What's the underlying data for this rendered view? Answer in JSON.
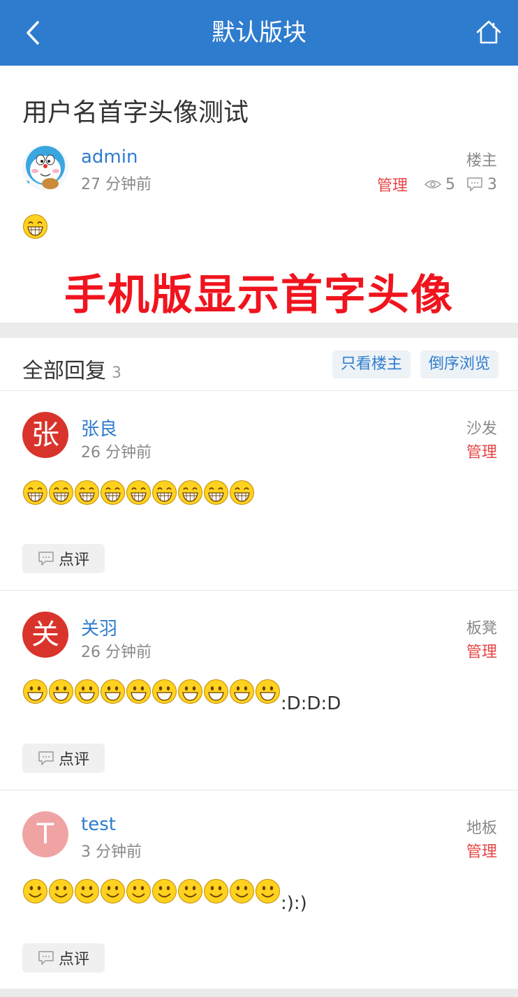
{
  "header": {
    "title": "默认版块"
  },
  "thread": {
    "subject": "用户名首字头像测试",
    "author": "admin",
    "time": "27 分钟前",
    "floor": "楼主",
    "manage": "管理",
    "views": "5",
    "replies": "3",
    "banner": "手机版显示首字头像"
  },
  "replies_section": {
    "label": "全部回复",
    "count": "3",
    "only_op_btn": "只看楼主",
    "reverse_btn": "倒序浏览"
  },
  "replies": [
    {
      "initial": "张",
      "author": "张良",
      "time": "26 分钟前",
      "floor": "沙发",
      "manage": "管理",
      "suffix_text": "",
      "comment": "点评",
      "avatar_color": "#d9342b",
      "emote": "grin",
      "emote_count": 9
    },
    {
      "initial": "关",
      "author": "关羽",
      "time": "26 分钟前",
      "floor": "板凳",
      "manage": "管理",
      "suffix_text": ":D:D:D",
      "comment": "点评",
      "avatar_color": "#d9342b",
      "emote": "bigsmile",
      "emote_count": 10
    },
    {
      "initial": "T",
      "author": "test",
      "time": "3 分钟前",
      "floor": "地板",
      "manage": "管理",
      "suffix_text": ":):)",
      "comment": "点评",
      "avatar_color": "#f0a3a3",
      "emote": "smile",
      "emote_count": 10
    }
  ]
}
